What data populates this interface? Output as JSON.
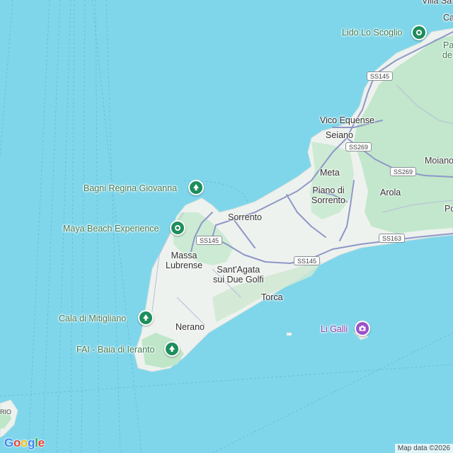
{
  "map": {
    "colors": {
      "sea": "#7fd6ea",
      "land": "#eef2ee",
      "vegetation": "#bfe6c9",
      "road": "#8f97c8",
      "poi_green": "#1e8e5c",
      "poi_purple": "#9b51c9"
    },
    "places": {
      "sorrento": "Sorrento",
      "vico_equense": "Vico Equense",
      "seiano": "Seiano",
      "meta": "Meta",
      "piano_di_sorrento_line1": "Piano di",
      "piano_di_sorrento_line2": "Sorrento",
      "arola": "Arola",
      "massa_lubrense_line1": "Massa",
      "massa_lubrense_line2": "Lubrense",
      "santagata_line1": "Sant'Agata",
      "santagata_line2": "sui Due Golfi",
      "torca": "Torca",
      "nerano": "Nerano",
      "moiano_partial": "Moiano",
      "po_partial": "Po",
      "ca_partial": "Ca",
      "villa_partial": "Villa Sa",
      "rio_partial": "RIO"
    },
    "pois": {
      "lido_lo_scoglio": "Lido Lo Scoglio",
      "bagni_regina_giovanna": "Bagni Regina Giovanna",
      "maya_beach": "Maya Beach Experience",
      "cala_di_mitigliano": "Cala di Mitigliano",
      "fai_baia": "FAI - Baia di Ieranto",
      "li_galli": "Li Galli",
      "pa_partial_1": "Pa",
      "pa_partial_2": "de"
    },
    "roads": {
      "ss145_a": "SS145",
      "ss145_b": "SS145",
      "ss145_c": "SS145",
      "ss269_a": "SS269",
      "ss269_b": "SS269",
      "ss163": "SS163"
    },
    "logo": "Google",
    "attribution": "Map data ©2026"
  }
}
